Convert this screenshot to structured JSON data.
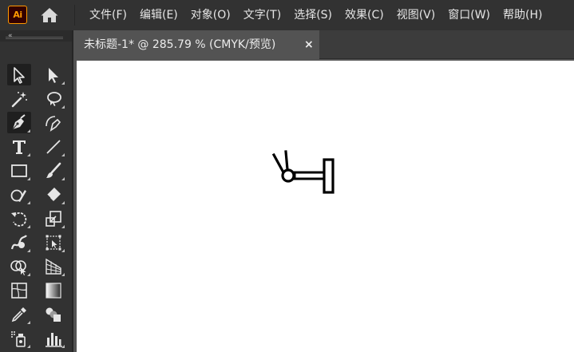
{
  "app": {
    "logo_text": "Ai",
    "logo_color": "#ff9a00",
    "home_icon": "home-icon"
  },
  "menu": {
    "items": [
      {
        "label": "文件(F)"
      },
      {
        "label": "编辑(E)"
      },
      {
        "label": "对象(O)"
      },
      {
        "label": "文字(T)"
      },
      {
        "label": "选择(S)"
      },
      {
        "label": "效果(C)"
      },
      {
        "label": "视图(V)"
      },
      {
        "label": "窗口(W)"
      },
      {
        "label": "帮助(H)"
      }
    ]
  },
  "panel": {
    "collapse_icon": "«"
  },
  "tools": [
    {
      "icon": "selection-tool-icon",
      "active": true
    },
    {
      "icon": "direct-selection-tool-icon",
      "active": false
    },
    {
      "icon": "magic-wand-tool-icon",
      "active": false
    },
    {
      "icon": "lasso-tool-icon",
      "active": false
    },
    {
      "icon": "pen-tool-icon",
      "active": true
    },
    {
      "icon": "curvature-tool-icon",
      "active": false
    },
    {
      "icon": "type-tool-icon",
      "active": false
    },
    {
      "icon": "line-segment-tool-icon",
      "active": false
    },
    {
      "icon": "rectangle-tool-icon",
      "active": false
    },
    {
      "icon": "paintbrush-tool-icon",
      "active": false
    },
    {
      "icon": "shaper-tool-icon",
      "active": false
    },
    {
      "icon": "eraser-tool-icon",
      "active": false
    },
    {
      "icon": "rotate-tool-icon",
      "active": false
    },
    {
      "icon": "scale-tool-icon",
      "active": false
    },
    {
      "icon": "warp-tool-icon",
      "active": false
    },
    {
      "icon": "free-transform-tool-icon",
      "active": false
    },
    {
      "icon": "shape-builder-tool-icon",
      "active": false
    },
    {
      "icon": "perspective-grid-tool-icon",
      "active": false
    },
    {
      "icon": "mesh-tool-icon",
      "active": false
    },
    {
      "icon": "gradient-tool-icon",
      "active": false
    },
    {
      "icon": "eyedropper-tool-icon",
      "active": false
    },
    {
      "icon": "blend-tool-icon",
      "active": false
    },
    {
      "icon": "symbol-sprayer-tool-icon",
      "active": false
    },
    {
      "icon": "column-graph-tool-icon",
      "active": false
    }
  ],
  "document": {
    "tab_title": "未标题-1* @ 285.79 % (CMYK/预览)",
    "close_label": "×"
  },
  "colors": {
    "menubar": "#323232",
    "workspace": "#535353",
    "artboard": "#ffffff",
    "stroke": "#000000"
  }
}
